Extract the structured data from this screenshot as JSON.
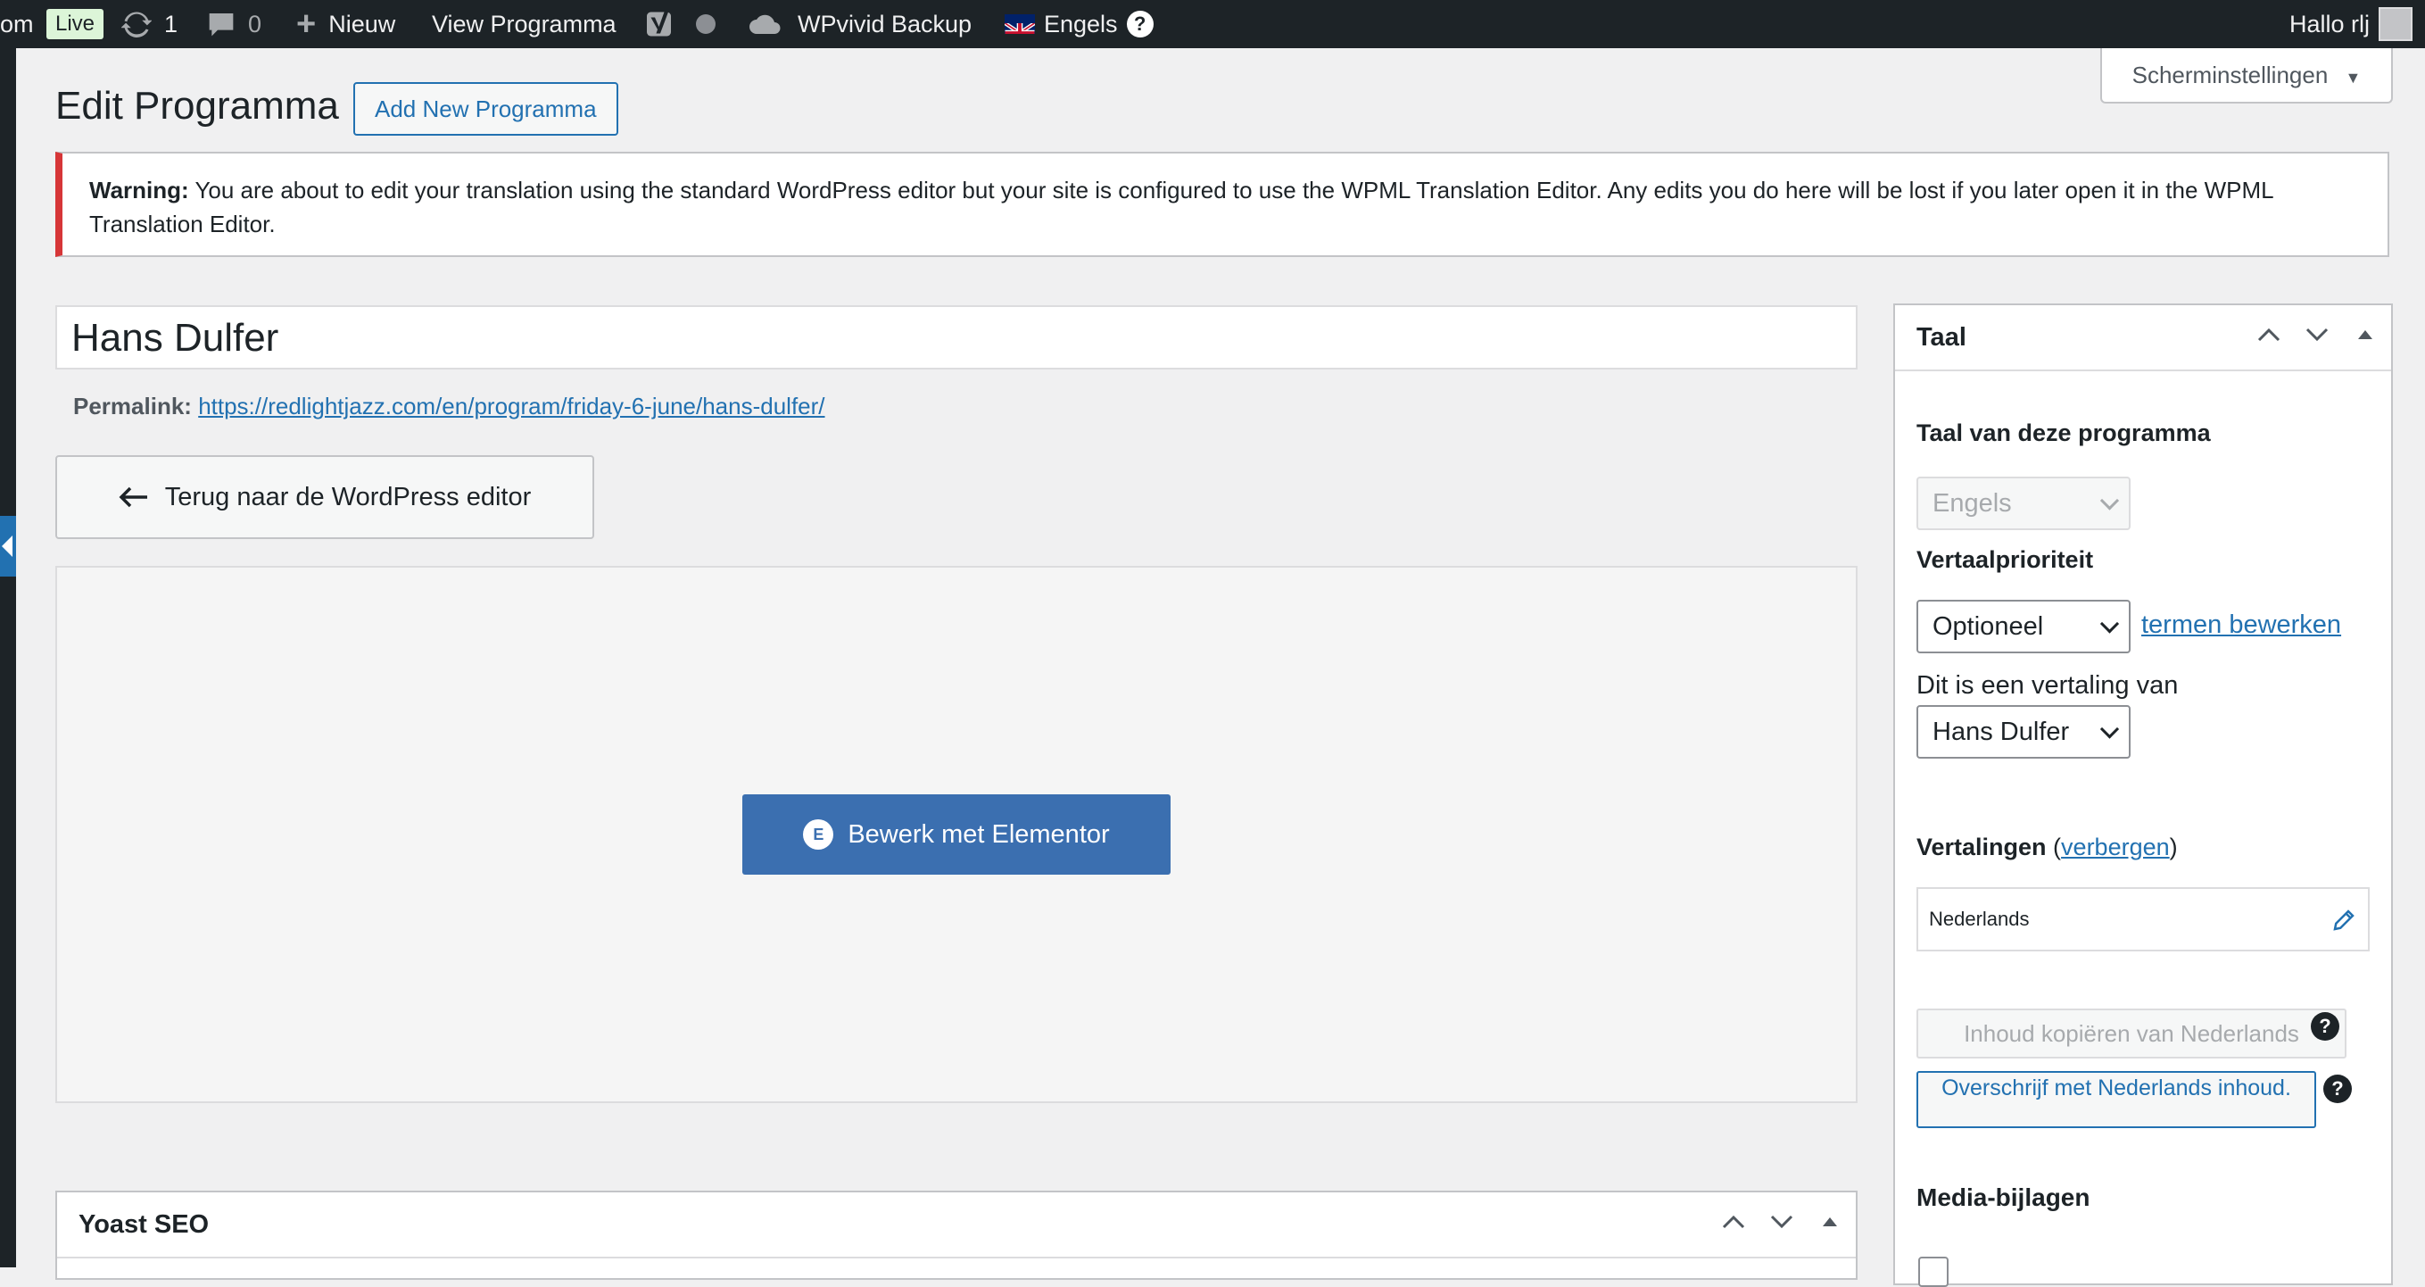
{
  "admin_bar": {
    "site_fragment": "om",
    "live_badge": "Live",
    "updates_count": "1",
    "comments_count": "0",
    "new_label": "Nieuw",
    "view_label": "View Programma",
    "wpvivid_label": "WPvivid Backup",
    "language_label": "Engels",
    "greeting": "Hallo rlj"
  },
  "header": {
    "title": "Edit Programma",
    "add_new": "Add New Programma",
    "screen_options": "Scherminstellingen"
  },
  "notice": {
    "strong": "Warning:",
    "text": " You are about to edit your translation using the standard WordPress editor but your site is configured to use the WPML Translation Editor. Any edits you do here will be lost if you later open it in the WPML Translation Editor."
  },
  "post": {
    "title": "Hans Dulfer",
    "permalink_label": "Permalink:",
    "permalink_url": "https://redlightjazz.com/en/program/friday-6-june/hans-dulfer/",
    "back_button": "Terug naar de WordPress editor",
    "elementor_button": "Bewerk met Elementor"
  },
  "yoast": {
    "title": "Yoast SEO"
  },
  "taal_box": {
    "title": "Taal",
    "language_label": "Taal van deze programma",
    "language_value": "Engels",
    "priority_label": "Vertaalprioriteit",
    "priority_value": "Optioneel",
    "edit_terms_link": "termen bewerken",
    "translation_of_label": "Dit is een vertaling van",
    "translation_of_value": "Hans Dulfer",
    "translations_label": "Vertalingen",
    "hide_link": "verbergen",
    "translation_language": "Nederlands",
    "copy_button": "Inhoud kopiëren van Nederlands",
    "overwrite_button": "Overschrijf met Nederlands inhoud.",
    "media_label": "Media-bijlagen"
  }
}
